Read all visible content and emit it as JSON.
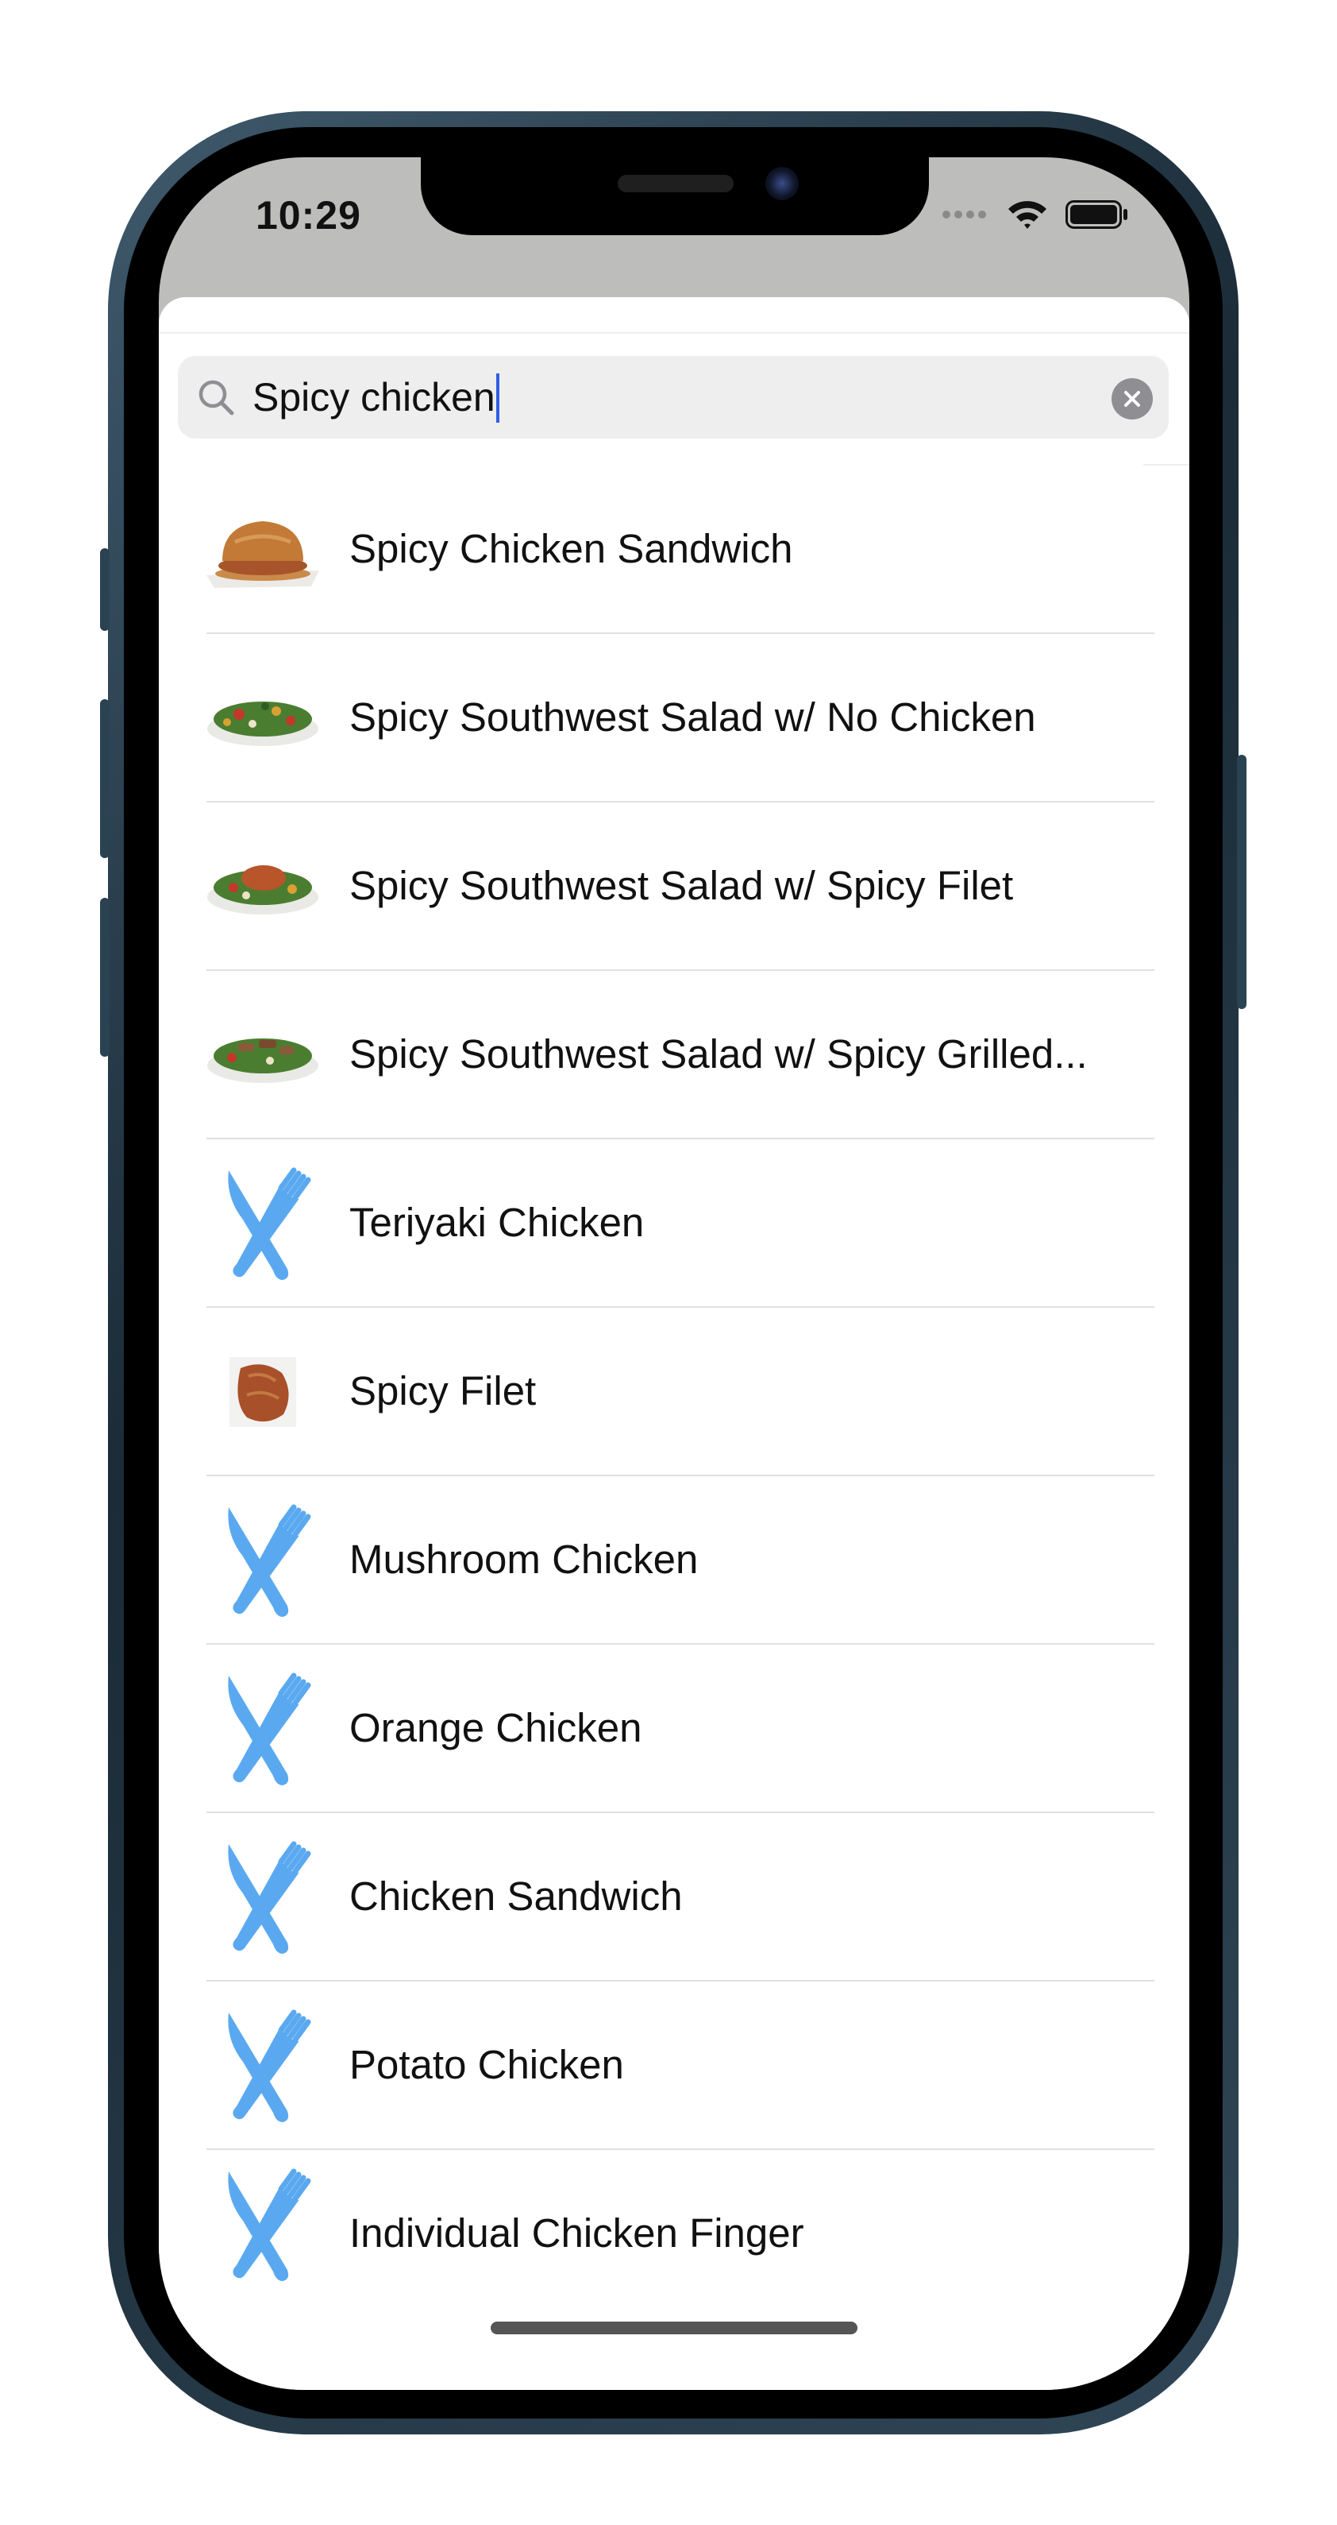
{
  "status_bar": {
    "time": "10:29"
  },
  "search": {
    "query": "Spicy chicken"
  },
  "results": [
    {
      "label": "Spicy Chicken Sandwich",
      "icon": "sandwich-thumbnail"
    },
    {
      "label": "Spicy Southwest Salad w/ No Chicken",
      "icon": "salad-thumbnail"
    },
    {
      "label": "Spicy Southwest Salad w/ Spicy Filet",
      "icon": "salad-filet-thumbnail"
    },
    {
      "label": "Spicy Southwest Salad w/ Spicy Grilled...",
      "icon": "salad-grilled-thumbnail"
    },
    {
      "label": "Teriyaki Chicken",
      "icon": "fork-knife-icon"
    },
    {
      "label": "Spicy Filet",
      "icon": "filet-thumbnail"
    },
    {
      "label": "Mushroom Chicken",
      "icon": "fork-knife-icon"
    },
    {
      "label": "Orange Chicken",
      "icon": "fork-knife-icon"
    },
    {
      "label": "Chicken Sandwich",
      "icon": "fork-knife-icon"
    },
    {
      "label": "Potato Chicken",
      "icon": "fork-knife-icon"
    },
    {
      "label": "Individual Chicken Finger",
      "icon": "fork-knife-icon"
    }
  ],
  "colors": {
    "accent_icon": "#5aa9f0",
    "caret": "#2f5fe6",
    "search_field": "#eeeeef",
    "clear_button": "#8e8e93"
  }
}
